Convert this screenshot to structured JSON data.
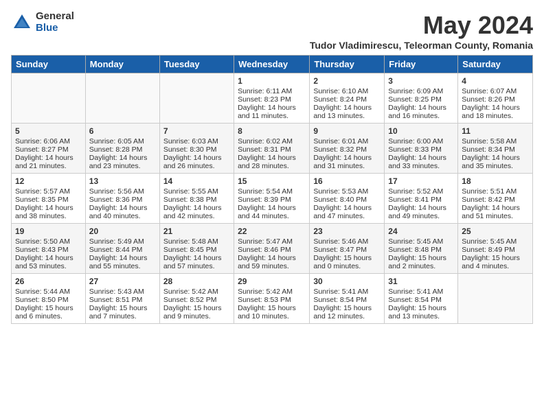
{
  "logo": {
    "general": "General",
    "blue": "Blue"
  },
  "header": {
    "month": "May 2024",
    "subtitle": "Tudor Vladimirescu, Teleorman County, Romania"
  },
  "weekdays": [
    "Sunday",
    "Monday",
    "Tuesday",
    "Wednesday",
    "Thursday",
    "Friday",
    "Saturday"
  ],
  "weeks": [
    [
      {
        "day": "",
        "info": ""
      },
      {
        "day": "",
        "info": ""
      },
      {
        "day": "",
        "info": ""
      },
      {
        "day": "1",
        "info": "Sunrise: 6:11 AM\nSunset: 8:23 PM\nDaylight: 14 hours\nand 11 minutes."
      },
      {
        "day": "2",
        "info": "Sunrise: 6:10 AM\nSunset: 8:24 PM\nDaylight: 14 hours\nand 13 minutes."
      },
      {
        "day": "3",
        "info": "Sunrise: 6:09 AM\nSunset: 8:25 PM\nDaylight: 14 hours\nand 16 minutes."
      },
      {
        "day": "4",
        "info": "Sunrise: 6:07 AM\nSunset: 8:26 PM\nDaylight: 14 hours\nand 18 minutes."
      }
    ],
    [
      {
        "day": "5",
        "info": "Sunrise: 6:06 AM\nSunset: 8:27 PM\nDaylight: 14 hours\nand 21 minutes."
      },
      {
        "day": "6",
        "info": "Sunrise: 6:05 AM\nSunset: 8:28 PM\nDaylight: 14 hours\nand 23 minutes."
      },
      {
        "day": "7",
        "info": "Sunrise: 6:03 AM\nSunset: 8:30 PM\nDaylight: 14 hours\nand 26 minutes."
      },
      {
        "day": "8",
        "info": "Sunrise: 6:02 AM\nSunset: 8:31 PM\nDaylight: 14 hours\nand 28 minutes."
      },
      {
        "day": "9",
        "info": "Sunrise: 6:01 AM\nSunset: 8:32 PM\nDaylight: 14 hours\nand 31 minutes."
      },
      {
        "day": "10",
        "info": "Sunrise: 6:00 AM\nSunset: 8:33 PM\nDaylight: 14 hours\nand 33 minutes."
      },
      {
        "day": "11",
        "info": "Sunrise: 5:58 AM\nSunset: 8:34 PM\nDaylight: 14 hours\nand 35 minutes."
      }
    ],
    [
      {
        "day": "12",
        "info": "Sunrise: 5:57 AM\nSunset: 8:35 PM\nDaylight: 14 hours\nand 38 minutes."
      },
      {
        "day": "13",
        "info": "Sunrise: 5:56 AM\nSunset: 8:36 PM\nDaylight: 14 hours\nand 40 minutes."
      },
      {
        "day": "14",
        "info": "Sunrise: 5:55 AM\nSunset: 8:38 PM\nDaylight: 14 hours\nand 42 minutes."
      },
      {
        "day": "15",
        "info": "Sunrise: 5:54 AM\nSunset: 8:39 PM\nDaylight: 14 hours\nand 44 minutes."
      },
      {
        "day": "16",
        "info": "Sunrise: 5:53 AM\nSunset: 8:40 PM\nDaylight: 14 hours\nand 47 minutes."
      },
      {
        "day": "17",
        "info": "Sunrise: 5:52 AM\nSunset: 8:41 PM\nDaylight: 14 hours\nand 49 minutes."
      },
      {
        "day": "18",
        "info": "Sunrise: 5:51 AM\nSunset: 8:42 PM\nDaylight: 14 hours\nand 51 minutes."
      }
    ],
    [
      {
        "day": "19",
        "info": "Sunrise: 5:50 AM\nSunset: 8:43 PM\nDaylight: 14 hours\nand 53 minutes."
      },
      {
        "day": "20",
        "info": "Sunrise: 5:49 AM\nSunset: 8:44 PM\nDaylight: 14 hours\nand 55 minutes."
      },
      {
        "day": "21",
        "info": "Sunrise: 5:48 AM\nSunset: 8:45 PM\nDaylight: 14 hours\nand 57 minutes."
      },
      {
        "day": "22",
        "info": "Sunrise: 5:47 AM\nSunset: 8:46 PM\nDaylight: 14 hours\nand 59 minutes."
      },
      {
        "day": "23",
        "info": "Sunrise: 5:46 AM\nSunset: 8:47 PM\nDaylight: 15 hours\nand 0 minutes."
      },
      {
        "day": "24",
        "info": "Sunrise: 5:45 AM\nSunset: 8:48 PM\nDaylight: 15 hours\nand 2 minutes."
      },
      {
        "day": "25",
        "info": "Sunrise: 5:45 AM\nSunset: 8:49 PM\nDaylight: 15 hours\nand 4 minutes."
      }
    ],
    [
      {
        "day": "26",
        "info": "Sunrise: 5:44 AM\nSunset: 8:50 PM\nDaylight: 15 hours\nand 6 minutes."
      },
      {
        "day": "27",
        "info": "Sunrise: 5:43 AM\nSunset: 8:51 PM\nDaylight: 15 hours\nand 7 minutes."
      },
      {
        "day": "28",
        "info": "Sunrise: 5:42 AM\nSunset: 8:52 PM\nDaylight: 15 hours\nand 9 minutes."
      },
      {
        "day": "29",
        "info": "Sunrise: 5:42 AM\nSunset: 8:53 PM\nDaylight: 15 hours\nand 10 minutes."
      },
      {
        "day": "30",
        "info": "Sunrise: 5:41 AM\nSunset: 8:54 PM\nDaylight: 15 hours\nand 12 minutes."
      },
      {
        "day": "31",
        "info": "Sunrise: 5:41 AM\nSunset: 8:54 PM\nDaylight: 15 hours\nand 13 minutes."
      },
      {
        "day": "",
        "info": ""
      }
    ]
  ]
}
